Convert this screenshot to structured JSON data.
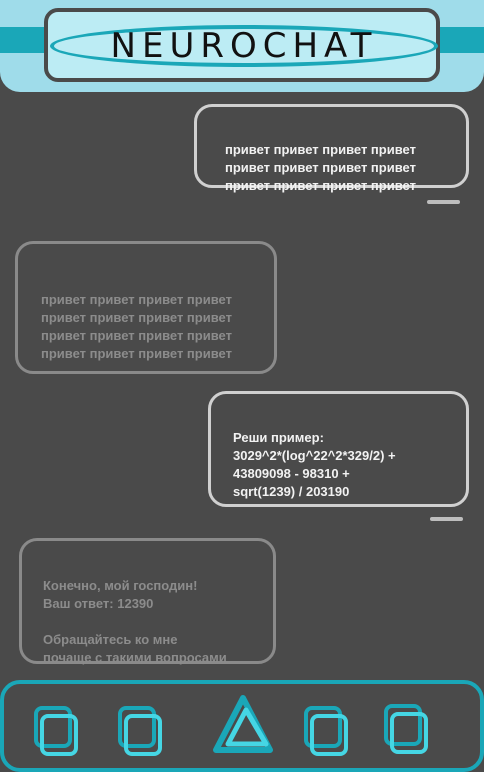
{
  "app": {
    "title": "NEUROCHAT"
  },
  "messages": [
    {
      "direction": "outgoing",
      "text": "привет привет привет привет\nпривет привет привет привет\nпривет привет привет привет"
    },
    {
      "direction": "incoming",
      "text": "привет привет привет привет\nпривет привет привет привет\nпривет привет привет привет\nпривет привет привет привет"
    },
    {
      "direction": "outgoing",
      "text": "Реши пример:\n3029^2*(log^22^2*329/2) +\n43809098 - 98310 +\nsqrt(1239) / 203190"
    },
    {
      "direction": "incoming",
      "text": "Конечно, мой господин!\nВаш ответ: 12390\n\nОбращайтесь ко мне\nпочаще с такими вопросами"
    }
  ],
  "footer": {
    "buttons": [
      "square-button-1",
      "square-button-2",
      "triangle-button",
      "square-button-3",
      "square-button-4"
    ]
  },
  "colors": {
    "accent": "#1aa7b8",
    "accent_light": "#9fdcea",
    "background": "#4a4a4a",
    "outgoing_border": "#d0d0d0",
    "incoming_border": "#8a8a8a"
  }
}
